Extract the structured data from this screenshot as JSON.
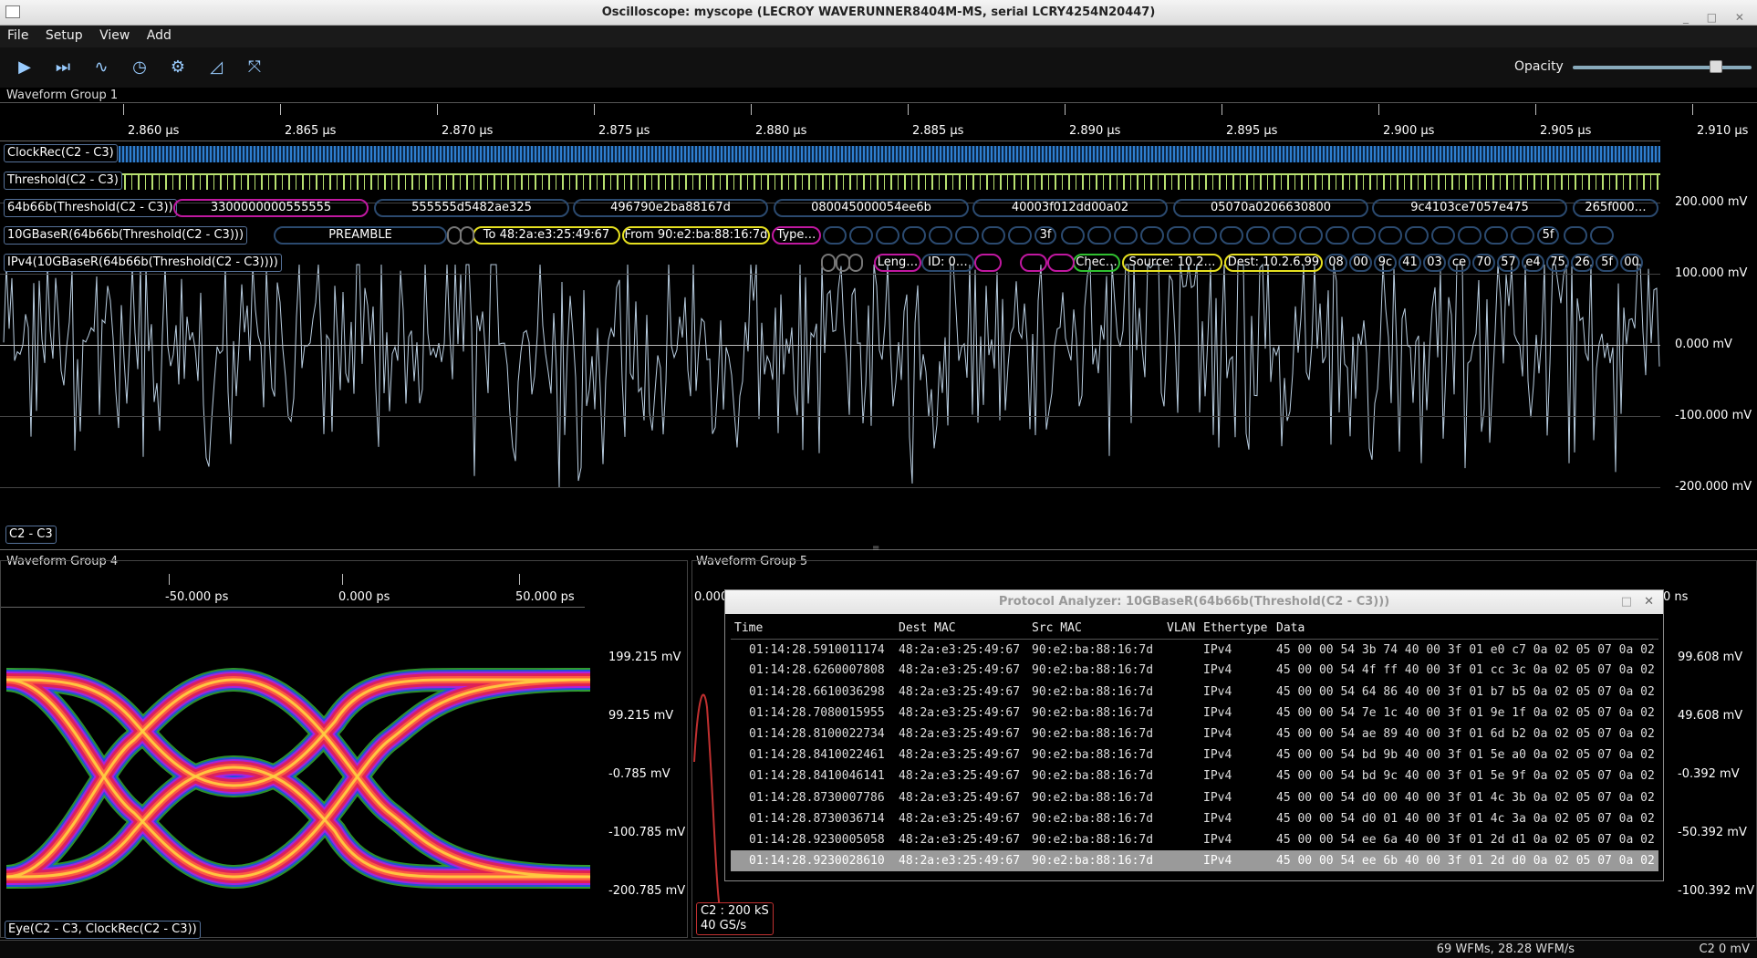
{
  "window": {
    "title": "Oscilloscope: myscope (LECROY WAVERUNNER8404M-MS, serial LCRY4254N20447)"
  },
  "menu": [
    "File",
    "Setup",
    "View",
    "Add"
  ],
  "toolbar": {
    "icons": [
      "run-icon",
      "single-step-icon",
      "waveform-icon",
      "history-icon",
      "settings-icon",
      "measure-icon",
      "fit-icon"
    ],
    "opacity_label": "Opacity",
    "opacity_value": 0.8
  },
  "group1": {
    "title": "Waveform Group 1",
    "ticks": [
      "2.860 µs",
      "2.865 µs",
      "2.870 µs",
      "2.875 µs",
      "2.880 µs",
      "2.885 µs",
      "2.890 µs",
      "2.895 µs",
      "2.900 µs",
      "2.905 µs",
      "2.910 µs"
    ],
    "y_labels": [
      "200.000 mV",
      "100.000 mV",
      "0.000 mV",
      "-100.000 mV",
      "-200.000 mV"
    ],
    "channels": [
      "ClockRec(C2 - C3)",
      "Threshold(C2 - C3)",
      "64b66b(Threshold(C2 - C3))",
      "10GBaseR(64b66b(Threshold(C2 - C3)))",
      "IPv4(10GBaseR(64b66b(Threshold(C2 - C3))))"
    ],
    "decode_64b66b": [
      "3300000000555555",
      "555555d5482ae325",
      "496790e2ba88167d",
      "080045000054ee6b",
      "40003f012dd00a02",
      "05070a0206630800",
      "9c4103ce7057e475",
      "265f000…"
    ],
    "decode_10gbaser": [
      "PREAMBLE",
      "To 48:2a:e3:25:49:67",
      "From 90:e2:ba:88:16:7d",
      "Type…",
      "3f",
      "5f"
    ],
    "decode_ipv4": [
      "Leng…",
      "ID: 0…",
      "Chec…",
      "Source: 10.2…",
      "Dest: 10.2.6.99",
      "08",
      "00",
      "9c",
      "41",
      "03",
      "ce",
      "70",
      "57",
      "e4",
      "75",
      "26",
      "5f",
      "00"
    ],
    "trace_label": "C2 - C3"
  },
  "group4": {
    "title": "Waveform Group 4",
    "ticks": [
      "-50.000 ps",
      "0.000 ps",
      "50.000 ps"
    ],
    "y_labels": [
      "199.215 mV",
      "99.215 mV",
      "-0.785 mV",
      "-100.785 mV",
      "-200.785 mV"
    ],
    "trace_label": "Eye(C2 - C3, ClockRec(C2 - C3))"
  },
  "group5": {
    "title": "Waveform Group 5",
    "tick_left": "0.000",
    "tick_right": "0 ns",
    "y_labels": [
      "99.608 mV",
      "49.608 mV",
      "-0.392 mV",
      "-50.392 mV",
      "-100.392 mV"
    ],
    "info_line1": "C2 : 200 kS",
    "info_line2": "40 GS/s"
  },
  "protocol_analyzer": {
    "title": "Protocol Analyzer: 10GBaseR(64b66b(Threshold(C2 - C3)))",
    "columns": [
      "Time",
      "Dest MAC",
      "Src MAC",
      "VLAN",
      "Ethertype",
      "Data"
    ],
    "rows": [
      [
        "01:14:28.5910011174",
        "48:2a:e3:25:49:67",
        "90:e2:ba:88:16:7d",
        "",
        "IPv4",
        "45 00 00 54 3b 74 40 00 3f 01 e0 c7 0a 02 05 07 0a 02"
      ],
      [
        "01:14:28.6260007808",
        "48:2a:e3:25:49:67",
        "90:e2:ba:88:16:7d",
        "",
        "IPv4",
        "45 00 00 54 4f ff 40 00 3f 01 cc 3c 0a 02 05 07 0a 02"
      ],
      [
        "01:14:28.6610036298",
        "48:2a:e3:25:49:67",
        "90:e2:ba:88:16:7d",
        "",
        "IPv4",
        "45 00 00 54 64 86 40 00 3f 01 b7 b5 0a 02 05 07 0a 02"
      ],
      [
        "01:14:28.7080015955",
        "48:2a:e3:25:49:67",
        "90:e2:ba:88:16:7d",
        "",
        "IPv4",
        "45 00 00 54 7e 1c 40 00 3f 01 9e 1f 0a 02 05 07 0a 02"
      ],
      [
        "01:14:28.8100022734",
        "48:2a:e3:25:49:67",
        "90:e2:ba:88:16:7d",
        "",
        "IPv4",
        "45 00 00 54 ae 89 40 00 3f 01 6d b2 0a 02 05 07 0a 02"
      ],
      [
        "01:14:28.8410022461",
        "48:2a:e3:25:49:67",
        "90:e2:ba:88:16:7d",
        "",
        "IPv4",
        "45 00 00 54 bd 9b 40 00 3f 01 5e a0 0a 02 05 07 0a 02"
      ],
      [
        "01:14:28.8410046141",
        "48:2a:e3:25:49:67",
        "90:e2:ba:88:16:7d",
        "",
        "IPv4",
        "45 00 00 54 bd 9c 40 00 3f 01 5e 9f 0a 02 05 07 0a 02"
      ],
      [
        "01:14:28.8730007786",
        "48:2a:e3:25:49:67",
        "90:e2:ba:88:16:7d",
        "",
        "IPv4",
        "45 00 00 54 d0 00 40 00 3f 01 4c 3b 0a 02 05 07 0a 02"
      ],
      [
        "01:14:28.8730036714",
        "48:2a:e3:25:49:67",
        "90:e2:ba:88:16:7d",
        "",
        "IPv4",
        "45 00 00 54 d0 01 40 00 3f 01 4c 3a 0a 02 05 07 0a 02"
      ],
      [
        "01:14:28.9230005058",
        "48:2a:e3:25:49:67",
        "90:e2:ba:88:16:7d",
        "",
        "IPv4",
        "45 00 00 54 ee 6a 40 00 3f 01 2d d1 0a 02 05 07 0a 02"
      ],
      [
        "01:14:28.9230028610",
        "48:2a:e3:25:49:67",
        "90:e2:ba:88:16:7d",
        "",
        "IPv4",
        "45 00 00 54 ee 6b 40 00 3f 01 2d d0 0a 02 05 07 0a 02"
      ]
    ],
    "selected_row": 10
  },
  "status": {
    "rate": "69 WFMs, 28.28 WFM/s",
    "trigger": "C2 0 mV"
  },
  "colors": {
    "clock": "#2f7fd0",
    "threshold": "#b8e070",
    "waveform": "#b8cde0",
    "decode_border": "#2b4a6f",
    "magenta": "#c018a0",
    "yellow": "#e6e020",
    "green": "#30c030",
    "red_trace": "#c03030"
  }
}
